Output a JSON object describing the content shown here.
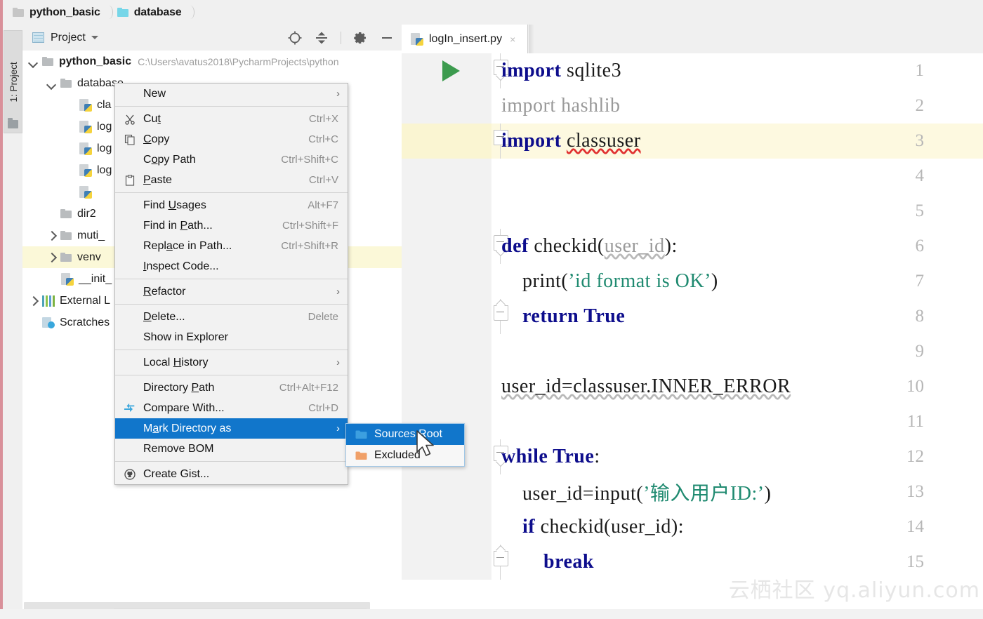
{
  "window": {
    "accent_color": "#1176cb",
    "highlight_row_color": "#fbf8d8"
  },
  "breadcrumb": {
    "name": "breadcrumb",
    "items": [
      {
        "label": "python_basic",
        "icon": "folder-icon"
      },
      {
        "label": "database",
        "icon": "folder-icon-cyan"
      }
    ]
  },
  "tool_strip": {
    "project_tab": "1: Project"
  },
  "project_panel": {
    "title": "Project",
    "toolbar": [
      {
        "name": "locate-icon",
        "tooltip": "Select Opened File"
      },
      {
        "name": "collapse-all-icon",
        "tooltip": "Collapse All"
      },
      {
        "name": "gear-icon",
        "tooltip": "Settings"
      },
      {
        "name": "minimize-icon",
        "tooltip": "Hide"
      }
    ],
    "tree": [
      {
        "label": "python_basic",
        "path": "C:\\Users\\avatus2018\\PycharmProjects\\python",
        "arrow": "down",
        "icon": "folder-icon",
        "bold": true,
        "indent": 0,
        "highlight": false
      },
      {
        "label": "database",
        "path": "",
        "arrow": "down",
        "icon": "folder-icon",
        "bold": false,
        "indent": 1,
        "highlight": false
      },
      {
        "label": "cla",
        "path": "",
        "arrow": "none",
        "icon": "python-file-icon",
        "bold": false,
        "indent": 2,
        "highlight": false
      },
      {
        "label": "log",
        "path": "",
        "arrow": "none",
        "icon": "python-file-icon",
        "bold": false,
        "indent": 2,
        "highlight": false
      },
      {
        "label": "log",
        "path": "",
        "arrow": "none",
        "icon": "python-file-icon",
        "bold": false,
        "indent": 2,
        "highlight": false
      },
      {
        "label": "log",
        "path": "",
        "arrow": "none",
        "icon": "python-file-icon",
        "bold": false,
        "indent": 2,
        "highlight": false
      },
      {
        "label": "",
        "path": "",
        "arrow": "none",
        "icon": "python-file-icon",
        "bold": false,
        "indent": 2,
        "highlight": false
      },
      {
        "label": "dir2",
        "path": "",
        "arrow": "none",
        "icon": "folder-icon",
        "bold": false,
        "indent": 1,
        "highlight": false
      },
      {
        "label": "muti_",
        "path": "",
        "arrow": "right",
        "icon": "folder-icon",
        "bold": false,
        "indent": 1,
        "highlight": false
      },
      {
        "label": "venv",
        "path": "",
        "arrow": "right",
        "icon": "folder-icon",
        "bold": false,
        "indent": 1,
        "highlight": true
      },
      {
        "label": "__init_",
        "path": "",
        "arrow": "none",
        "icon": "python-file-icon",
        "bold": false,
        "indent": 1,
        "highlight": false
      },
      {
        "label": "External L",
        "path": "",
        "arrow": "right",
        "icon": "library-icon",
        "bold": false,
        "indent": 0,
        "highlight": false
      },
      {
        "label": "Scratches",
        "path": "",
        "arrow": "none",
        "icon": "scratches-icon",
        "bold": false,
        "indent": 0,
        "highlight": false
      }
    ]
  },
  "editor": {
    "tab": {
      "label": "logIn_insert.py",
      "close": "×",
      "icon": "python-file-icon"
    },
    "lines": [
      {
        "num": "1",
        "run_arrow": true,
        "fold": "start",
        "highlight": false,
        "segments": [
          {
            "t": "import ",
            "c": "kw"
          },
          {
            "t": "sqlite3",
            "c": "mod"
          }
        ]
      },
      {
        "num": "2",
        "run_arrow": false,
        "fold": "none",
        "highlight": false,
        "segments": [
          {
            "t": "import hashlib",
            "c": "dim"
          }
        ]
      },
      {
        "num": "3",
        "run_arrow": false,
        "fold": "mid",
        "highlight": true,
        "segments": [
          {
            "t": "import ",
            "c": "kw"
          },
          {
            "t": "classuser",
            "c": "err"
          }
        ]
      },
      {
        "num": "4",
        "run_arrow": false,
        "fold": "none",
        "highlight": false,
        "segments": []
      },
      {
        "num": "5",
        "run_arrow": false,
        "fold": "none",
        "highlight": false,
        "segments": []
      },
      {
        "num": "6",
        "run_arrow": false,
        "fold": "start",
        "highlight": false,
        "segments": [
          {
            "t": "def ",
            "c": "kw"
          },
          {
            "t": "checkid",
            "c": "mod"
          },
          {
            "t": "(",
            "c": "mod"
          },
          {
            "t": "user_id",
            "c": "dimwave"
          },
          {
            "t": "):",
            "c": "mod"
          }
        ]
      },
      {
        "num": "7",
        "run_arrow": false,
        "fold": "none",
        "highlight": false,
        "segments": [
          {
            "t": "    print",
            "c": "mod"
          },
          {
            "t": "(",
            "c": "mod"
          },
          {
            "t": "’id format is OK’",
            "c": "str"
          },
          {
            "t": ")",
            "c": "mod"
          }
        ]
      },
      {
        "num": "8",
        "run_arrow": false,
        "fold": "end",
        "highlight": false,
        "segments": [
          {
            "t": "    ",
            "c": "mod"
          },
          {
            "t": "return ",
            "c": "kw"
          },
          {
            "t": "True",
            "c": "kw"
          }
        ]
      },
      {
        "num": "9",
        "run_arrow": false,
        "fold": "none",
        "highlight": false,
        "segments": []
      },
      {
        "num": "10",
        "run_arrow": false,
        "fold": "none",
        "highlight": false,
        "segments": [
          {
            "t": "user_id=classuser.INNER_ERROR",
            "c": "wavy"
          }
        ]
      },
      {
        "num": "11",
        "run_arrow": false,
        "fold": "none",
        "highlight": false,
        "segments": []
      },
      {
        "num": "12",
        "run_arrow": false,
        "fold": "start",
        "highlight": false,
        "segments": [
          {
            "t": "while ",
            "c": "kw"
          },
          {
            "t": "True",
            "c": "kw"
          },
          {
            "t": ":",
            "c": "mod"
          }
        ]
      },
      {
        "num": "13",
        "run_arrow": false,
        "fold": "none",
        "highlight": false,
        "segments": [
          {
            "t": "    user_id=input",
            "c": "mod"
          },
          {
            "t": "(",
            "c": "mod"
          },
          {
            "t": "’输入用户ID:’",
            "c": "str"
          },
          {
            "t": ")",
            "c": "mod"
          }
        ]
      },
      {
        "num": "14",
        "run_arrow": false,
        "fold": "none",
        "highlight": false,
        "segments": [
          {
            "t": "    ",
            "c": "mod"
          },
          {
            "t": "if ",
            "c": "kw"
          },
          {
            "t": "checkid(user_id):",
            "c": "mod"
          }
        ]
      },
      {
        "num": "15",
        "run_arrow": false,
        "fold": "end",
        "highlight": false,
        "segments": [
          {
            "t": "        ",
            "c": "mod"
          },
          {
            "t": "break",
            "c": "kw"
          }
        ]
      }
    ]
  },
  "context_menu": {
    "name": "file-context-menu",
    "items": [
      {
        "label": "New",
        "shortcut": "",
        "submenu": true,
        "icon": "",
        "selected": false,
        "sep_after": true,
        "mnemonic": ""
      },
      {
        "label": "Cut",
        "shortcut": "Ctrl+X",
        "submenu": false,
        "icon": "cut-icon",
        "selected": false,
        "sep_after": false,
        "mnemonic": "t"
      },
      {
        "label": "Copy",
        "shortcut": "Ctrl+C",
        "submenu": false,
        "icon": "copy-icon",
        "selected": false,
        "sep_after": false,
        "mnemonic": "C"
      },
      {
        "label": "Copy Path",
        "shortcut": "Ctrl+Shift+C",
        "submenu": false,
        "icon": "",
        "selected": false,
        "sep_after": false,
        "mnemonic": "o"
      },
      {
        "label": "Paste",
        "shortcut": "Ctrl+V",
        "submenu": false,
        "icon": "paste-icon",
        "selected": false,
        "sep_after": true,
        "mnemonic": "P"
      },
      {
        "label": "Find Usages",
        "shortcut": "Alt+F7",
        "submenu": false,
        "icon": "",
        "selected": false,
        "sep_after": false,
        "mnemonic": "U"
      },
      {
        "label": "Find in Path...",
        "shortcut": "Ctrl+Shift+F",
        "submenu": false,
        "icon": "",
        "selected": false,
        "sep_after": false,
        "mnemonic": "P"
      },
      {
        "label": "Replace in Path...",
        "shortcut": "Ctrl+Shift+R",
        "submenu": false,
        "icon": "",
        "selected": false,
        "sep_after": false,
        "mnemonic": "a"
      },
      {
        "label": "Inspect Code...",
        "shortcut": "",
        "submenu": false,
        "icon": "",
        "selected": false,
        "sep_after": true,
        "mnemonic": "I"
      },
      {
        "label": "Refactor",
        "shortcut": "",
        "submenu": true,
        "icon": "",
        "selected": false,
        "sep_after": true,
        "mnemonic": "R"
      },
      {
        "label": "Delete...",
        "shortcut": "Delete",
        "submenu": false,
        "icon": "",
        "selected": false,
        "sep_after": false,
        "mnemonic": "D"
      },
      {
        "label": "Show in Explorer",
        "shortcut": "",
        "submenu": false,
        "icon": "",
        "selected": false,
        "sep_after": true,
        "mnemonic": ""
      },
      {
        "label": "Local History",
        "shortcut": "",
        "submenu": true,
        "icon": "",
        "selected": false,
        "sep_after": true,
        "mnemonic": "H"
      },
      {
        "label": "Directory Path",
        "shortcut": "Ctrl+Alt+F12",
        "submenu": false,
        "icon": "",
        "selected": false,
        "sep_after": false,
        "mnemonic": "P"
      },
      {
        "label": "Compare With...",
        "shortcut": "Ctrl+D",
        "submenu": false,
        "icon": "compare-icon",
        "selected": false,
        "sep_after": false,
        "mnemonic": ""
      },
      {
        "label": "Mark Directory as",
        "shortcut": "",
        "submenu": true,
        "icon": "",
        "selected": true,
        "sep_after": false,
        "mnemonic": "a"
      },
      {
        "label": "Remove BOM",
        "shortcut": "",
        "submenu": false,
        "icon": "",
        "selected": false,
        "sep_after": true,
        "mnemonic": ""
      },
      {
        "label": "Create Gist...",
        "shortcut": "",
        "submenu": false,
        "icon": "github-icon",
        "selected": false,
        "sep_after": false,
        "mnemonic": ""
      }
    ]
  },
  "context_submenu": {
    "name": "mark-directory-as-submenu",
    "items": [
      {
        "label": "Sources Root",
        "icon": "sources-root-folder-icon",
        "selected": true
      },
      {
        "label": "Excluded",
        "icon": "excluded-folder-icon",
        "selected": false
      }
    ]
  },
  "watermark": {
    "text": "云栖社区 yq.aliyun.com"
  }
}
